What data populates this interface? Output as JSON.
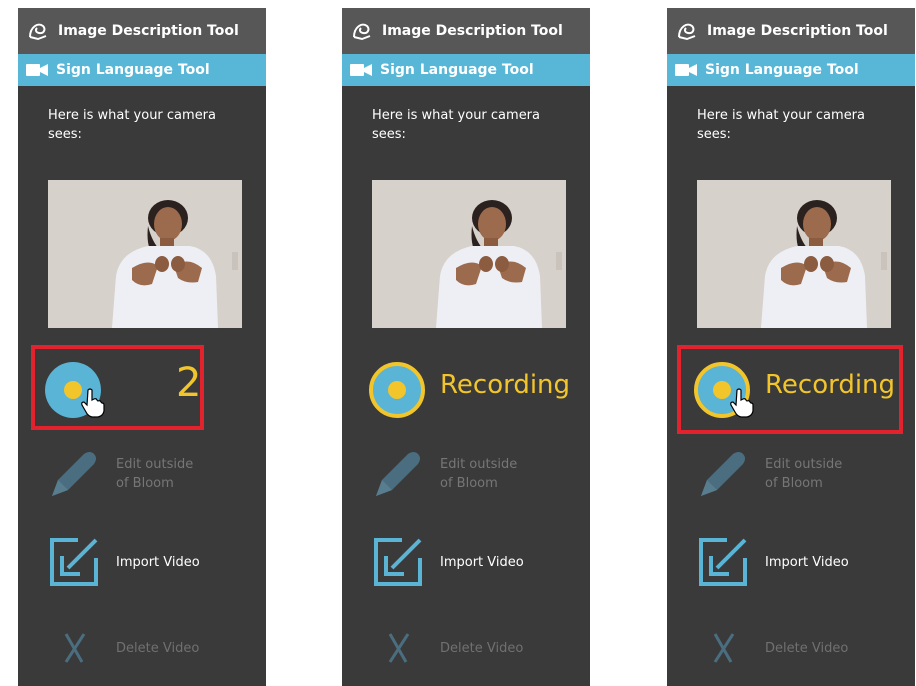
{
  "header": {
    "title": "Image Description Tool",
    "icon": "image-description-icon"
  },
  "tool_header": {
    "title": "Sign Language Tool",
    "icon": "video-camera-icon"
  },
  "camera_intro": "Here is what your camera sees:",
  "panels": [
    {
      "record_state": "countdown",
      "countdown": "2",
      "highlighted": true,
      "cursor": true
    },
    {
      "record_state": "recording",
      "recording_label": "Recording",
      "highlighted": false,
      "cursor": false
    },
    {
      "record_state": "recording",
      "recording_label": "Recording",
      "highlighted": true,
      "cursor": true
    }
  ],
  "tools": {
    "edit_outside": "Edit outside of Bloom",
    "import_video": "Import Video",
    "delete_video": "Delete Video"
  },
  "colors": {
    "panel_bg": "#3a3a3a",
    "header_bg": "#575757",
    "tool_header_bg": "#58b6d6",
    "accent_yellow": "#f2c52b",
    "accent_blue": "#5ab4d6",
    "highlight_red": "#e2222c"
  }
}
